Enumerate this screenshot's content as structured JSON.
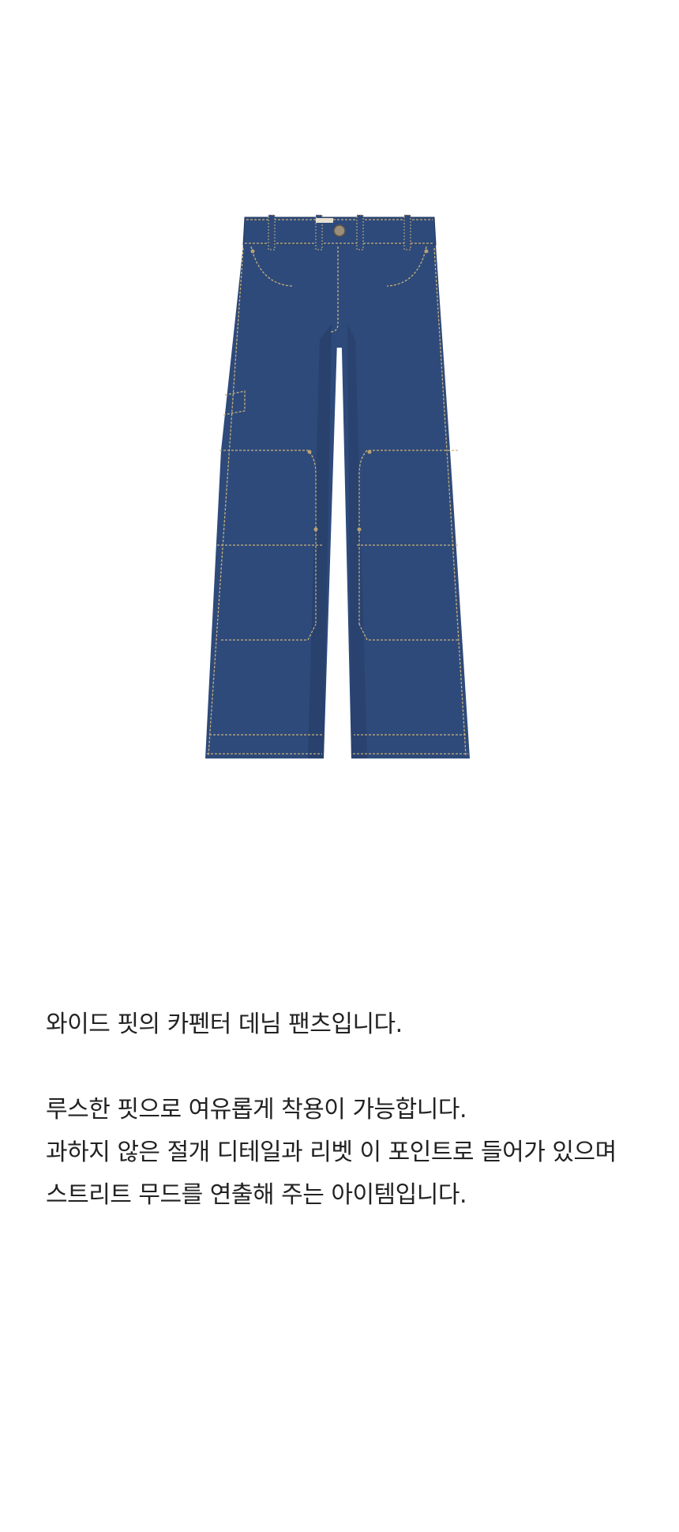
{
  "product": {
    "image_icon": "wide-carpenter-denim-pants",
    "colors": {
      "denim": "#2e4a7a",
      "denim_shadow": "#22385f",
      "stitch": "#c9b07a",
      "background": "#ffffff",
      "text": "#222222"
    }
  },
  "description": {
    "intro": "와이드 핏의 카펜터 데님 팬츠입니다.",
    "line1": "루스한 핏으로 여유롭게 착용이 가능합니다.",
    "line2": "과하지 않은 절개 디테일과 리벳 이 포인트로 들어가 있으며",
    "line3": "스트리트 무드를 연출해 주는 아이템입니다."
  }
}
